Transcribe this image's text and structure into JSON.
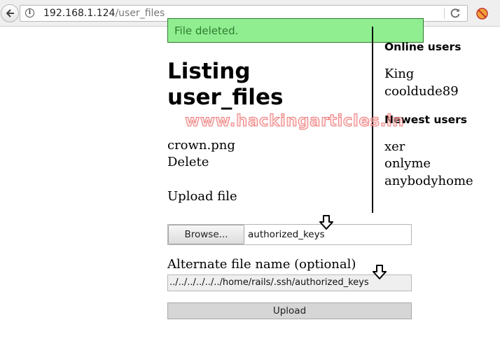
{
  "browser": {
    "url_host": "192.168.1.124",
    "url_path": "/user_files",
    "icons": {
      "back": "back-arrow-icon",
      "info": "info-icon",
      "reload": "reload-icon",
      "addon": "addon-icon"
    }
  },
  "flash": {
    "message": "File deleted."
  },
  "main": {
    "title_line1": "Listing",
    "title_line2": "user_files",
    "file_name": "crown.png",
    "delete_link": "Delete",
    "upload_heading": "Upload file",
    "browse_label": "Browse...",
    "selected_file": "authorized_keys",
    "alt_name_label": "Alternate file name (optional)",
    "alt_name_value": "../../../../../../home/rails/.ssh/authorized_keys",
    "upload_button": "Upload"
  },
  "sidebar": {
    "online_heading": "Online users",
    "online_users": [
      "King",
      "cooldude89"
    ],
    "newest_heading": "Newest users",
    "newest_users": [
      "xer",
      "onlyme",
      "anybodyhome"
    ]
  },
  "watermark": "www.hackingarticles.in",
  "colors": {
    "flash_bg": "#90ee90",
    "flash_text": "#2e7d2e",
    "watermark": "#e65050"
  }
}
